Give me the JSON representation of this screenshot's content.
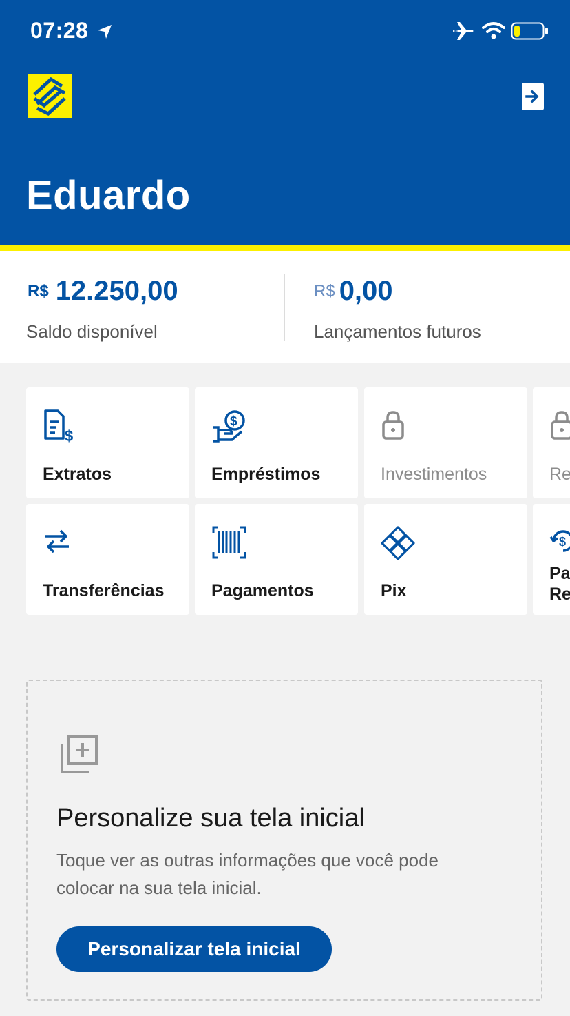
{
  "status_bar": {
    "time": "07:28"
  },
  "header": {
    "user_name": "Eduardo"
  },
  "balances": [
    {
      "currency": "R$",
      "value": "12.250,00",
      "label": "Saldo disponível"
    },
    {
      "currency": "R$",
      "value": "0,00",
      "label": "Lançamentos futuros"
    }
  ],
  "tiles": [
    {
      "label": "Extratos",
      "icon": "statement-icon",
      "locked": false
    },
    {
      "label": "Empréstimos",
      "icon": "loan-icon",
      "locked": false
    },
    {
      "label": "Investimentos",
      "icon": "lock-icon",
      "locked": true
    },
    {
      "label": "Re",
      "icon": "lock-icon",
      "locked": true
    },
    {
      "label": "Transferências",
      "icon": "transfer-arrows-icon",
      "locked": false
    },
    {
      "label": "Pagamentos",
      "icon": "barcode-icon",
      "locked": false
    },
    {
      "label": "Pix",
      "icon": "pix-icon",
      "locked": false
    },
    {
      "label": "Pa",
      "label_line2": "Re",
      "icon": "recurring-payment-icon",
      "locked": false
    }
  ],
  "customize": {
    "title": "Personalize sua tela inicial",
    "description": "Toque ver as outras informações que você pode colocar na sua tela inicial.",
    "button_label": "Personalizar tela inicial"
  },
  "colors": {
    "brand_blue": "#0353a4",
    "brand_yellow": "#fcf000"
  }
}
